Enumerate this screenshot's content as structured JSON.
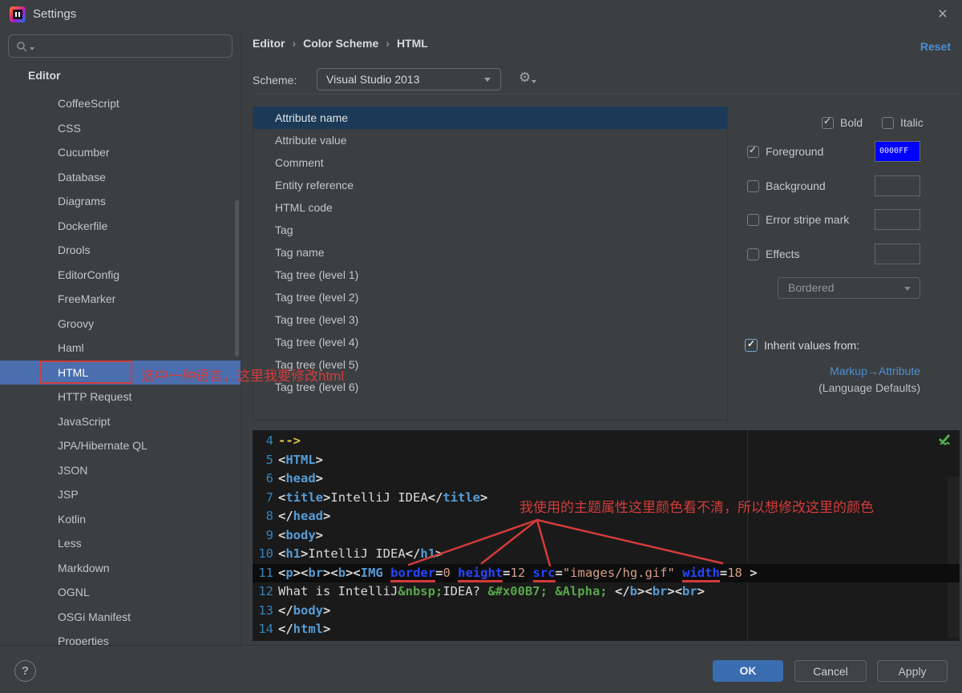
{
  "window": {
    "title": "Settings",
    "close_icon": "×"
  },
  "sidebar": {
    "search_placeholder": "",
    "root_item": "Editor",
    "items": [
      "CoffeeScript",
      "CSS",
      "Cucumber",
      "Database",
      "Diagrams",
      "Dockerfile",
      "Drools",
      "EditorConfig",
      "FreeMarker",
      "Groovy",
      "Haml",
      "HTML",
      "HTTP Request",
      "JavaScript",
      "JPA/Hibernate QL",
      "JSON",
      "JSP",
      "Kotlin",
      "Less",
      "Markdown",
      "OGNL",
      "OSGi Manifest",
      "Properties"
    ],
    "selected_item": "HTML"
  },
  "header": {
    "breadcrumb": [
      "Editor",
      "Color Scheme",
      "HTML"
    ],
    "breadcrumb_separator": "›",
    "reset_label": "Reset",
    "scheme_label": "Scheme:",
    "scheme_value": "Visual Studio 2013"
  },
  "attribute_list": {
    "items": [
      "Attribute name",
      "Attribute value",
      "Comment",
      "Entity reference",
      "HTML code",
      "Tag",
      "Tag name",
      "Tag tree (level 1)",
      "Tag tree (level 2)",
      "Tag tree (level 3)",
      "Tag tree (level 4)",
      "Tag tree (level 5)",
      "Tag tree (level 6)"
    ],
    "selected_item": "Attribute name"
  },
  "options": {
    "bold_label": "Bold",
    "bold_checked": true,
    "italic_label": "Italic",
    "italic_checked": false,
    "foreground_label": "Foreground",
    "foreground_checked": true,
    "foreground_color": "#0000FF",
    "foreground_swatch_text": "0000FF",
    "background_label": "Background",
    "background_checked": false,
    "error_stripe_label": "Error stripe mark",
    "error_stripe_checked": false,
    "effects_label": "Effects",
    "effects_checked": false,
    "effect_type_value": "Bordered",
    "inherit_label": "Inherit values from:",
    "inherit_checked": true,
    "inherit_link": "Markup→Attribute",
    "inherit_note": "(Language Defaults)"
  },
  "editor": {
    "lines": [
      {
        "n": "4",
        "current": false,
        "tokens": [
          {
            "t": "-->",
            "c": "cm"
          }
        ]
      },
      {
        "n": "5",
        "current": false,
        "tokens": [
          {
            "t": "<",
            "c": "br"
          },
          {
            "t": "HTML",
            "c": "tag"
          },
          {
            "t": ">",
            "c": "br"
          }
        ]
      },
      {
        "n": "6",
        "current": false,
        "tokens": [
          {
            "t": "<",
            "c": "br"
          },
          {
            "t": "head",
            "c": "tag"
          },
          {
            "t": ">",
            "c": "br"
          }
        ]
      },
      {
        "n": "7",
        "current": false,
        "tokens": [
          {
            "t": "<",
            "c": "br"
          },
          {
            "t": "title",
            "c": "tag"
          },
          {
            "t": ">",
            "c": "br"
          },
          {
            "t": "IntelliJ IDEA",
            "c": "txt"
          },
          {
            "t": "</",
            "c": "br"
          },
          {
            "t": "title",
            "c": "tag"
          },
          {
            "t": ">",
            "c": "br"
          }
        ]
      },
      {
        "n": "8",
        "current": false,
        "tokens": [
          {
            "t": "</",
            "c": "br"
          },
          {
            "t": "head",
            "c": "tag"
          },
          {
            "t": ">",
            "c": "br"
          }
        ]
      },
      {
        "n": "9",
        "current": false,
        "tokens": [
          {
            "t": "<",
            "c": "br"
          },
          {
            "t": "body",
            "c": "tag"
          },
          {
            "t": ">",
            "c": "br"
          }
        ]
      },
      {
        "n": "10",
        "current": false,
        "tokens": [
          {
            "t": "<",
            "c": "br"
          },
          {
            "t": "h1",
            "c": "tag"
          },
          {
            "t": ">",
            "c": "br"
          },
          {
            "t": "IntelliJ IDEA",
            "c": "txt"
          },
          {
            "t": "</",
            "c": "br"
          },
          {
            "t": "h1",
            "c": "tag"
          },
          {
            "t": ">",
            "c": "br"
          }
        ]
      },
      {
        "n": "11",
        "current": true,
        "tokens": [
          {
            "t": "<",
            "c": "br"
          },
          {
            "t": "p",
            "c": "tag"
          },
          {
            "t": ">",
            "c": "br"
          },
          {
            "t": "<",
            "c": "br"
          },
          {
            "t": "br",
            "c": "tag"
          },
          {
            "t": ">",
            "c": "br"
          },
          {
            "t": "<",
            "c": "br"
          },
          {
            "t": "b",
            "c": "tag"
          },
          {
            "t": ">",
            "c": "br"
          },
          {
            "t": "<",
            "c": "br"
          },
          {
            "t": "IMG",
            "c": "tag"
          },
          {
            "t": " ",
            "c": "txt"
          },
          {
            "t": "border",
            "c": "attr u"
          },
          {
            "t": "=",
            "c": "br"
          },
          {
            "t": "0",
            "c": "val"
          },
          {
            "t": " ",
            "c": "txt"
          },
          {
            "t": "height",
            "c": "attr u"
          },
          {
            "t": "=",
            "c": "br"
          },
          {
            "t": "12",
            "c": "val"
          },
          {
            "t": " ",
            "c": "txt"
          },
          {
            "t": "src",
            "c": "attr u"
          },
          {
            "t": "=",
            "c": "br"
          },
          {
            "t": "\"images/hg.gif\"",
            "c": "val"
          },
          {
            "t": " ",
            "c": "txt"
          },
          {
            "t": "width",
            "c": "attr u"
          },
          {
            "t": "=",
            "c": "br"
          },
          {
            "t": "18",
            "c": "val"
          },
          {
            "t": " >",
            "c": "br"
          }
        ]
      },
      {
        "n": "12",
        "current": false,
        "tokens": [
          {
            "t": "What is IntelliJ",
            "c": "txt"
          },
          {
            "t": "&nbsp;",
            "c": "ent"
          },
          {
            "t": "IDEA? ",
            "c": "txt"
          },
          {
            "t": "&#x00B7;",
            "c": "ent"
          },
          {
            "t": " ",
            "c": "txt"
          },
          {
            "t": "&Alpha;",
            "c": "ent"
          },
          {
            "t": " ",
            "c": "txt"
          },
          {
            "t": "</",
            "c": "br"
          },
          {
            "t": "b",
            "c": "tag"
          },
          {
            "t": ">",
            "c": "br"
          },
          {
            "t": "<",
            "c": "br"
          },
          {
            "t": "br",
            "c": "tag"
          },
          {
            "t": ">",
            "c": "br"
          },
          {
            "t": "<",
            "c": "br"
          },
          {
            "t": "br",
            "c": "tag"
          },
          {
            "t": ">",
            "c": "br"
          }
        ]
      },
      {
        "n": "13",
        "current": false,
        "tokens": [
          {
            "t": "</",
            "c": "br"
          },
          {
            "t": "body",
            "c": "tag"
          },
          {
            "t": ">",
            "c": "br"
          }
        ]
      },
      {
        "n": "14",
        "current": false,
        "tokens": [
          {
            "t": "</",
            "c": "br"
          },
          {
            "t": "html",
            "c": "tag"
          },
          {
            "t": ">",
            "c": "br"
          }
        ]
      }
    ]
  },
  "annotations": {
    "sidebar_note": "选中一种语言，这里我要修改html",
    "editor_note": "我使用的主题属性这里颜色看不清，所以想修改这里的颜色",
    "annotation_color": "#d23b3b"
  },
  "footer": {
    "ok_label": "OK",
    "cancel_label": "Cancel",
    "apply_label": "Apply",
    "help_label": "?"
  },
  "colors": {
    "selection_blue": "#4a6eae",
    "list_selection_navy": "#1b3a57",
    "link_blue": "#4a8fd4",
    "ok_button_blue": "#3a6cb0",
    "foreground_swatch": "#0000FF",
    "editor_background": "#1a1a1a"
  }
}
